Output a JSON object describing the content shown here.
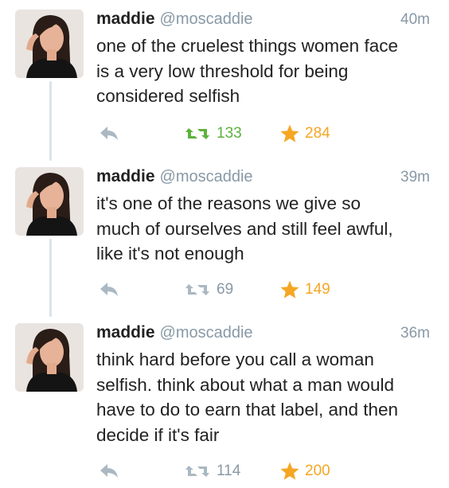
{
  "tweets": [
    {
      "name": "maddie",
      "handle": "@moscaddie",
      "time": "40m",
      "lines": [
        "one of the cruelest things women face",
        "is a very low threshold for being",
        "considered selfish"
      ],
      "retweets": "133",
      "favorites": "284",
      "retweet_active": true
    },
    {
      "name": "maddie",
      "handle": "@moscaddie",
      "time": "39m",
      "lines": [
        "it's one of the reasons we give so",
        "much of ourselves and still feel awful,",
        "like it's not enough"
      ],
      "retweets": "69",
      "favorites": "149",
      "retweet_active": false
    },
    {
      "name": "maddie",
      "handle": "@moscaddie",
      "time": "36m",
      "lines": [
        "think hard before you call a woman",
        "selfish. think about what a man would",
        "have to do to earn that label, and then",
        "decide if it's fair"
      ],
      "retweets": "114",
      "favorites": "200",
      "retweet_active": false
    }
  ],
  "colors": {
    "retweet_active": "#5fb13d",
    "retweet_inactive": "#8899a6",
    "favorite": "#f5a623",
    "reply": "#aab8c2"
  },
  "icons": {
    "reply": "reply-arrow-icon",
    "retweet": "retweet-icon",
    "favorite": "star-icon"
  }
}
